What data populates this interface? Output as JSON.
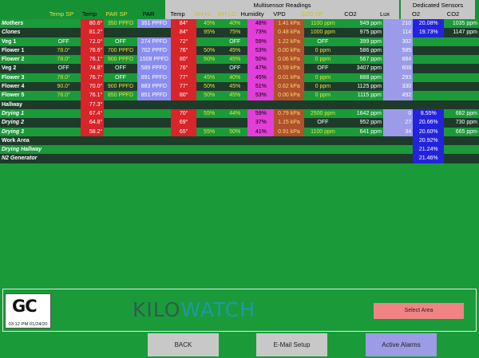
{
  "header": {
    "multisensor_title": "Multisensor Readings",
    "dedicated_title": "Dedicated Sensors",
    "columns": {
      "temp_sp": "Temp SP",
      "temp": "Temp",
      "par_sp": "PAR SP",
      "par": "PAR",
      "ms_temp": "Temp",
      "rh_hi": "RH Hi",
      "rh_lo": "RH LO",
      "humidity": "Humidity",
      "vpd": "VPD",
      "co2_sp": "CO2 SP",
      "co2": "CO2",
      "lux": "Lux",
      "o2": "O2",
      "ds_co2": "CO2"
    }
  },
  "rows": [
    {
      "name": "Mothers",
      "italic": true,
      "temp_sp": "",
      "temp": "80.6°",
      "par_sp": "350 PPFD",
      "par": "351 PPFD",
      "ms_temp": "84°",
      "rh_hi": "45%",
      "rh_lo": "40%",
      "humidity": "48%",
      "vpd": "1.41 kPa",
      "co2_sp": "1100 ppm",
      "co2": "949 ppm",
      "lux": "210",
      "o2": "20.08%",
      "ds_co2": "1035 ppm"
    },
    {
      "name": "Clones",
      "italic": true,
      "temp_sp": "",
      "temp": "81.2°",
      "par_sp": "",
      "par": "",
      "ms_temp": "84°",
      "rh_hi": "95%",
      "rh_lo": "75%",
      "humidity": "73%",
      "vpd": "0.48 kPa",
      "co2_sp": "1000 ppm",
      "co2": "975 ppm",
      "lux": "114",
      "o2": "19.73%",
      "ds_co2": "1147 ppm"
    },
    {
      "name": "Veg 1",
      "italic": false,
      "temp_sp": "OFF",
      "temp": "72.0°",
      "par_sp": "OFF",
      "par": "274 PPFD",
      "ms_temp": "72°",
      "rh_hi": "",
      "rh_lo": "OFF",
      "humidity": "59%",
      "vpd": "1.22 kPa",
      "co2_sp": "OFF",
      "co2": "399 ppm",
      "lux": "302",
      "o2": "",
      "ds_co2": ""
    },
    {
      "name": "Flower 1",
      "italic": false,
      "temp_sp": "78.0°",
      "temp": "76.6°",
      "par_sp": "700 PPFD",
      "par": "702 PPFD",
      "ms_temp": "76°",
      "rh_hi": "50%",
      "rh_lo": "45%",
      "humidity": "53%",
      "vpd": "0.00 kPa",
      "co2_sp": "0 ppm",
      "co2": "586 ppm",
      "lux": "585",
      "o2": "",
      "ds_co2": ""
    },
    {
      "name": "Flower 2",
      "italic": false,
      "temp_sp": "78.0°",
      "temp": "76.1°",
      "par_sp": "900 PPFD",
      "par": "1508 PPFD",
      "ms_temp": "80°",
      "rh_hi": "50%",
      "rh_lo": "45%",
      "humidity": "50%",
      "vpd": "0.06 kPa",
      "co2_sp": "0 ppm",
      "co2": "567 ppm",
      "lux": "684",
      "o2": "",
      "ds_co2": ""
    },
    {
      "name": "Veg 2",
      "italic": false,
      "temp_sp": "OFF",
      "temp": "74.8°",
      "par_sp": "OFF",
      "par": "589 PPFD",
      "ms_temp": "76°",
      "rh_hi": "",
      "rh_lo": "OFF",
      "humidity": "47%",
      "vpd": "0.59 kPa",
      "co2_sp": "OFF",
      "co2": "3407 ppm",
      "lux": "609",
      "o2": "",
      "ds_co2": ""
    },
    {
      "name": "Flower 3",
      "italic": false,
      "temp_sp": "78.0°",
      "temp": "76.7°",
      "par_sp": "OFF",
      "par": "891 PPFD",
      "ms_temp": "77°",
      "rh_hi": "45%",
      "rh_lo": "40%",
      "humidity": "45%",
      "vpd": "0.01 kPa",
      "co2_sp": "0 ppm",
      "co2": "888 ppm",
      "lux": "293",
      "o2": "",
      "ds_co2": ""
    },
    {
      "name": "Flower 4",
      "italic": false,
      "temp_sp": "90.0°",
      "temp": "70.0°",
      "par_sp": "900 PPFD",
      "par": "883 PPFD",
      "ms_temp": "77°",
      "rh_hi": "50%",
      "rh_lo": "45%",
      "humidity": "51%",
      "vpd": "0.62 kPa",
      "co2_sp": "0 ppm",
      "co2": "1125 ppm",
      "lux": "330",
      "o2": "",
      "ds_co2": ""
    },
    {
      "name": "Flower 5",
      "italic": false,
      "temp_sp": "78.0°",
      "temp": "76.1°",
      "par_sp": "850 PPFD",
      "par": "851 PPFD",
      "ms_temp": "80°",
      "rh_hi": "50%",
      "rh_lo": "45%",
      "humidity": "53%",
      "vpd": "0.00 kPa",
      "co2_sp": "0 ppm",
      "co2": "1115 ppm",
      "lux": "492",
      "o2": "",
      "ds_co2": ""
    },
    {
      "name": "Hallway",
      "italic": false,
      "temp_sp": "",
      "temp": "77.3°",
      "par_sp": "",
      "par": "",
      "ms_temp": "",
      "rh_hi": "",
      "rh_lo": "",
      "humidity": "",
      "vpd": "",
      "co2_sp": "",
      "co2": "",
      "lux": "",
      "o2": "",
      "ds_co2": ""
    },
    {
      "name": "Drying 1",
      "italic": true,
      "temp_sp": "",
      "temp": "67.4°",
      "par_sp": "",
      "par": "",
      "ms_temp": "70°",
      "rh_hi": "55%",
      "rh_lo": "44%",
      "humidity": "59%",
      "vpd": "0.79 kPa",
      "co2_sp": "2500 ppm",
      "co2": "1642 ppm",
      "lux": "0",
      "o2": "8.55%",
      "ds_co2": "682 ppm"
    },
    {
      "name": "Drying 2",
      "italic": true,
      "temp_sp": "",
      "temp": "64.8°",
      "par_sp": "",
      "par": "",
      "ms_temp": "69°",
      "rh_hi": "",
      "rh_lo": "",
      "humidity": "37%",
      "vpd": "1.15 kPa",
      "co2_sp": "OFF",
      "co2": "952 ppm",
      "lux": "27",
      "o2": "20.66%",
      "ds_co2": "730 ppm"
    },
    {
      "name": "Drying 3",
      "italic": true,
      "temp_sp": "",
      "temp": "58.2°",
      "par_sp": "",
      "par": "",
      "ms_temp": "65°",
      "rh_hi": "55%",
      "rh_lo": "50%",
      "humidity": "41%",
      "vpd": "0.91 kPa",
      "co2_sp": "1100 ppm",
      "co2": "641 ppm",
      "lux": "34",
      "o2": "20.60%",
      "ds_co2": "665 ppm"
    },
    {
      "name": "Work Area",
      "italic": false,
      "temp_sp": "",
      "temp": "",
      "par_sp": "",
      "par": "",
      "ms_temp": "",
      "rh_hi": "",
      "rh_lo": "",
      "humidity": "",
      "vpd": "",
      "co2_sp": "",
      "co2": "",
      "lux": "",
      "o2": "20.92%",
      "ds_co2": ""
    },
    {
      "name": "Drying Hallway",
      "italic": true,
      "temp_sp": "",
      "temp": "",
      "par_sp": "",
      "par": "",
      "ms_temp": "",
      "rh_hi": "",
      "rh_lo": "",
      "humidity": "",
      "vpd": "",
      "co2_sp": "",
      "co2": "",
      "lux": "",
      "o2": "21.24%",
      "ds_co2": ""
    },
    {
      "name": "N2 Generator",
      "italic": true,
      "temp_sp": "",
      "temp": "",
      "par_sp": "",
      "par": "",
      "ms_temp": "",
      "rh_hi": "",
      "rh_lo": "",
      "humidity": "",
      "vpd": "",
      "co2_sp": "",
      "co2": "",
      "lux": "",
      "o2": "21.46%",
      "ds_co2": ""
    }
  ],
  "logo": {
    "mark": "GC",
    "timestamp": "03:12 PM 01/24/20"
  },
  "brand": {
    "part1": "KILO",
    "part2": "WATCH"
  },
  "buttons": {
    "select_area": "Select Area",
    "back": "BACK",
    "email_setup": "E-Mail Setup",
    "active_alarms": "Active Alarms"
  },
  "colors": {
    "background": "#1b9a3a",
    "row_dark": "#1e3b2a",
    "temp_red": "#d7252a",
    "par_blue": "#8a8df0",
    "humidity_magenta": "#e23fd8",
    "vpd_orange": "#b0512b",
    "lux_purple": "#9b9bea",
    "o2_blue": "#2323dd",
    "setpoint_yellow": "#e6e23a",
    "select_button": "#f08484",
    "button_grey": "#c8c8c8",
    "alarm_purple": "#9c9ce6"
  }
}
